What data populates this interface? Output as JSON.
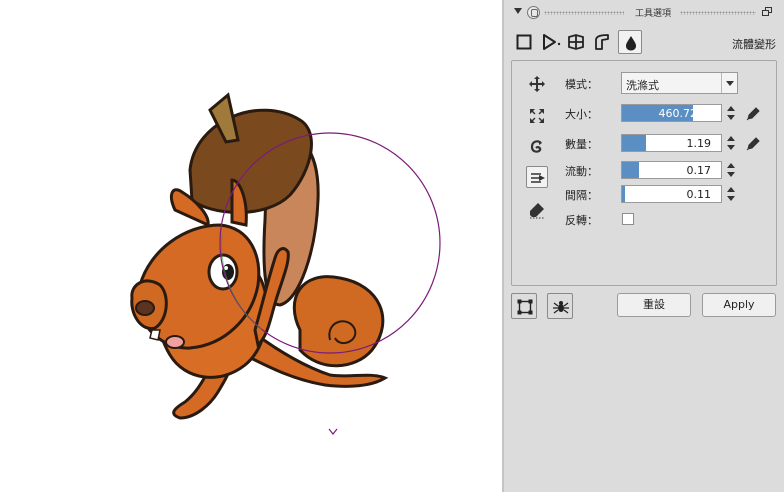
{
  "panel": {
    "title": "工具選項",
    "active_tool_name": "流體變形",
    "tools": [
      "square-tool-icon",
      "play-tool-icon",
      "cube-tool-icon",
      "shape-tool-icon",
      "liquid-drop-icon"
    ]
  },
  "params": {
    "mode_label": "模式：",
    "mode_value": "洗滌式",
    "size_label": "大小：",
    "size_value": "460.72",
    "size_fraction": 0.72,
    "amount_label": "數量：",
    "amount_value": "1.19",
    "amount_fraction": 0.24,
    "flow_label": "流動：",
    "flow_value": "0.17",
    "flow_fraction": 0.17,
    "spacing_label": "間隔：",
    "spacing_value": "0.11",
    "spacing_fraction": 0.03,
    "reverse_label": "反轉：",
    "reverse_checked": false
  },
  "buttons": {
    "reset_label": "重設",
    "apply_label": "Apply"
  },
  "colors": {
    "panel_bg": "#dcdcdc",
    "slider_fill": "#5b8ec3",
    "brush_circle": "#7a1c7a"
  }
}
